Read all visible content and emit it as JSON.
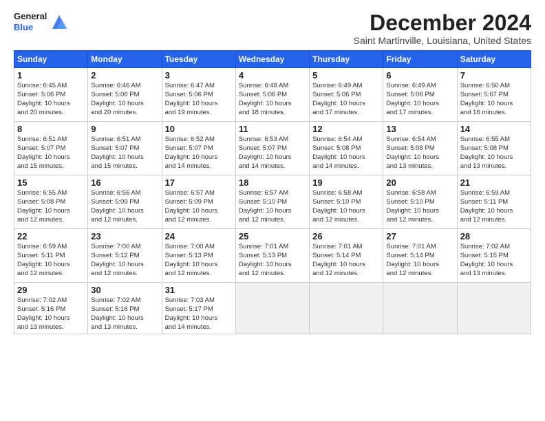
{
  "header": {
    "logo_general": "General",
    "logo_blue": "Blue",
    "month_title": "December 2024",
    "location": "Saint Martinville, Louisiana, United States"
  },
  "weekdays": [
    "Sunday",
    "Monday",
    "Tuesday",
    "Wednesday",
    "Thursday",
    "Friday",
    "Saturday"
  ],
  "weeks": [
    [
      {
        "day": "1",
        "info": "Sunrise: 6:45 AM\nSunset: 5:06 PM\nDaylight: 10 hours\nand 20 minutes."
      },
      {
        "day": "2",
        "info": "Sunrise: 6:46 AM\nSunset: 5:06 PM\nDaylight: 10 hours\nand 20 minutes."
      },
      {
        "day": "3",
        "info": "Sunrise: 6:47 AM\nSunset: 5:06 PM\nDaylight: 10 hours\nand 19 minutes."
      },
      {
        "day": "4",
        "info": "Sunrise: 6:48 AM\nSunset: 5:06 PM\nDaylight: 10 hours\nand 18 minutes."
      },
      {
        "day": "5",
        "info": "Sunrise: 6:49 AM\nSunset: 5:06 PM\nDaylight: 10 hours\nand 17 minutes."
      },
      {
        "day": "6",
        "info": "Sunrise: 6:49 AM\nSunset: 5:06 PM\nDaylight: 10 hours\nand 17 minutes."
      },
      {
        "day": "7",
        "info": "Sunrise: 6:50 AM\nSunset: 5:07 PM\nDaylight: 10 hours\nand 16 minutes."
      }
    ],
    [
      {
        "day": "8",
        "info": "Sunrise: 6:51 AM\nSunset: 5:07 PM\nDaylight: 10 hours\nand 15 minutes."
      },
      {
        "day": "9",
        "info": "Sunrise: 6:51 AM\nSunset: 5:07 PM\nDaylight: 10 hours\nand 15 minutes."
      },
      {
        "day": "10",
        "info": "Sunrise: 6:52 AM\nSunset: 5:07 PM\nDaylight: 10 hours\nand 14 minutes."
      },
      {
        "day": "11",
        "info": "Sunrise: 6:53 AM\nSunset: 5:07 PM\nDaylight: 10 hours\nand 14 minutes."
      },
      {
        "day": "12",
        "info": "Sunrise: 6:54 AM\nSunset: 5:08 PM\nDaylight: 10 hours\nand 14 minutes."
      },
      {
        "day": "13",
        "info": "Sunrise: 6:54 AM\nSunset: 5:08 PM\nDaylight: 10 hours\nand 13 minutes."
      },
      {
        "day": "14",
        "info": "Sunrise: 6:55 AM\nSunset: 5:08 PM\nDaylight: 10 hours\nand 13 minutes."
      }
    ],
    [
      {
        "day": "15",
        "info": "Sunrise: 6:55 AM\nSunset: 5:08 PM\nDaylight: 10 hours\nand 12 minutes."
      },
      {
        "day": "16",
        "info": "Sunrise: 6:56 AM\nSunset: 5:09 PM\nDaylight: 10 hours\nand 12 minutes."
      },
      {
        "day": "17",
        "info": "Sunrise: 6:57 AM\nSunset: 5:09 PM\nDaylight: 10 hours\nand 12 minutes."
      },
      {
        "day": "18",
        "info": "Sunrise: 6:57 AM\nSunset: 5:10 PM\nDaylight: 10 hours\nand 12 minutes."
      },
      {
        "day": "19",
        "info": "Sunrise: 6:58 AM\nSunset: 5:10 PM\nDaylight: 10 hours\nand 12 minutes."
      },
      {
        "day": "20",
        "info": "Sunrise: 6:58 AM\nSunset: 5:10 PM\nDaylight: 10 hours\nand 12 minutes."
      },
      {
        "day": "21",
        "info": "Sunrise: 6:59 AM\nSunset: 5:11 PM\nDaylight: 10 hours\nand 12 minutes."
      }
    ],
    [
      {
        "day": "22",
        "info": "Sunrise: 6:59 AM\nSunset: 5:11 PM\nDaylight: 10 hours\nand 12 minutes."
      },
      {
        "day": "23",
        "info": "Sunrise: 7:00 AM\nSunset: 5:12 PM\nDaylight: 10 hours\nand 12 minutes."
      },
      {
        "day": "24",
        "info": "Sunrise: 7:00 AM\nSunset: 5:13 PM\nDaylight: 10 hours\nand 12 minutes."
      },
      {
        "day": "25",
        "info": "Sunrise: 7:01 AM\nSunset: 5:13 PM\nDaylight: 10 hours\nand 12 minutes."
      },
      {
        "day": "26",
        "info": "Sunrise: 7:01 AM\nSunset: 5:14 PM\nDaylight: 10 hours\nand 12 minutes."
      },
      {
        "day": "27",
        "info": "Sunrise: 7:01 AM\nSunset: 5:14 PM\nDaylight: 10 hours\nand 12 minutes."
      },
      {
        "day": "28",
        "info": "Sunrise: 7:02 AM\nSunset: 5:15 PM\nDaylight: 10 hours\nand 13 minutes."
      }
    ],
    [
      {
        "day": "29",
        "info": "Sunrise: 7:02 AM\nSunset: 5:16 PM\nDaylight: 10 hours\nand 13 minutes."
      },
      {
        "day": "30",
        "info": "Sunrise: 7:02 AM\nSunset: 5:16 PM\nDaylight: 10 hours\nand 13 minutes."
      },
      {
        "day": "31",
        "info": "Sunrise: 7:03 AM\nSunset: 5:17 PM\nDaylight: 10 hours\nand 14 minutes."
      },
      {
        "day": "",
        "info": ""
      },
      {
        "day": "",
        "info": ""
      },
      {
        "day": "",
        "info": ""
      },
      {
        "day": "",
        "info": ""
      }
    ]
  ]
}
